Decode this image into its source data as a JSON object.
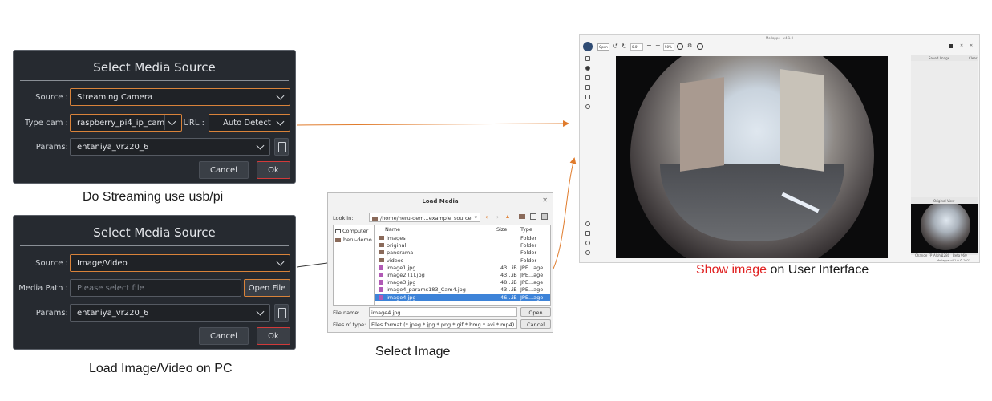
{
  "streaming_dialog": {
    "title": "Select Media Source",
    "source_label": "Source :",
    "source_value": "Streaming Camera",
    "type_cam_label": "Type cam :",
    "type_cam_value": "raspberry_pi4_ip_cam",
    "url_label": "URL :",
    "url_value": "Auto Detect",
    "params_label": "Params:",
    "params_value": "entaniya_vr220_6",
    "cancel_label": "Cancel",
    "ok_label": "Ok",
    "caption": "Do Streaming use usb/pi"
  },
  "file_dialog": {
    "title": "Select Media Source",
    "source_label": "Source :",
    "source_value": "Image/Video",
    "media_path_label": "Media Path :",
    "media_path_placeholder": "Please select file",
    "open_file_label": "Open File",
    "params_label": "Params:",
    "params_value": "entaniya_vr220_6",
    "cancel_label": "Cancel",
    "ok_label": "Ok",
    "caption": "Load Image/Video on PC"
  },
  "load_media": {
    "title": "Load Media",
    "look_in_label": "Look in:",
    "look_in_path": "/home/heru-dem...example_source",
    "places": [
      "Computer",
      "heru-demo"
    ],
    "columns": [
      "Name",
      "Size",
      "Type"
    ],
    "rows": [
      {
        "name": "images",
        "size": "",
        "type": "Folder",
        "kind": "folder"
      },
      {
        "name": "original",
        "size": "",
        "type": "Folder",
        "kind": "folder"
      },
      {
        "name": "panorama",
        "size": "",
        "type": "Folder",
        "kind": "folder"
      },
      {
        "name": "videos",
        "size": "",
        "type": "Folder",
        "kind": "folder"
      },
      {
        "name": "image1.jpg",
        "size": "43...iB",
        "type": "JPE...age",
        "kind": "image"
      },
      {
        "name": "image2 (1).jpg",
        "size": "43...iB",
        "type": "JPE...age",
        "kind": "image"
      },
      {
        "name": "image3.jpg",
        "size": "48...iB",
        "type": "JPE...age",
        "kind": "image"
      },
      {
        "name": "image4_params183_Cam4.jpg",
        "size": "43...iB",
        "type": "JPE...age",
        "kind": "image"
      },
      {
        "name": "image4.jpg",
        "size": "46...iB",
        "type": "JPE...age",
        "kind": "image",
        "selected": true
      }
    ],
    "file_name_label": "File name:",
    "file_name_value": "image4.jpg",
    "files_of_type_label": "Files of type:",
    "files_of_type_value": "Files format (*.jpeg *.jpg *.png *.gif *.bmg *.avi *.mp4)",
    "open_label": "Open",
    "cancel_label": "Cancel",
    "caption": "Select Image"
  },
  "main_ui": {
    "window_title": "Moilapps - v4.1.0",
    "open_label": "Open",
    "zoom_value": "0.0°",
    "zoom_percent": "50%",
    "saved_image_label": "Saved Image",
    "clear_label": "Clear",
    "original_view_label": "Original View",
    "status_left": "Change FP",
    "status_alpha": "Alpha",
    "status_alpha_value": "1280",
    "status_beta": "Beta",
    "status_beta_value": "960",
    "footer": "Moilapps v4.1.0 © 2023",
    "caption_highlight": "Show image",
    "caption_rest": " on User Interface"
  },
  "colors": {
    "accent_orange": "#d9833a",
    "ok_red": "#d23a3a",
    "caption_red": "#e02020",
    "dialog_bg": "#262a30"
  }
}
